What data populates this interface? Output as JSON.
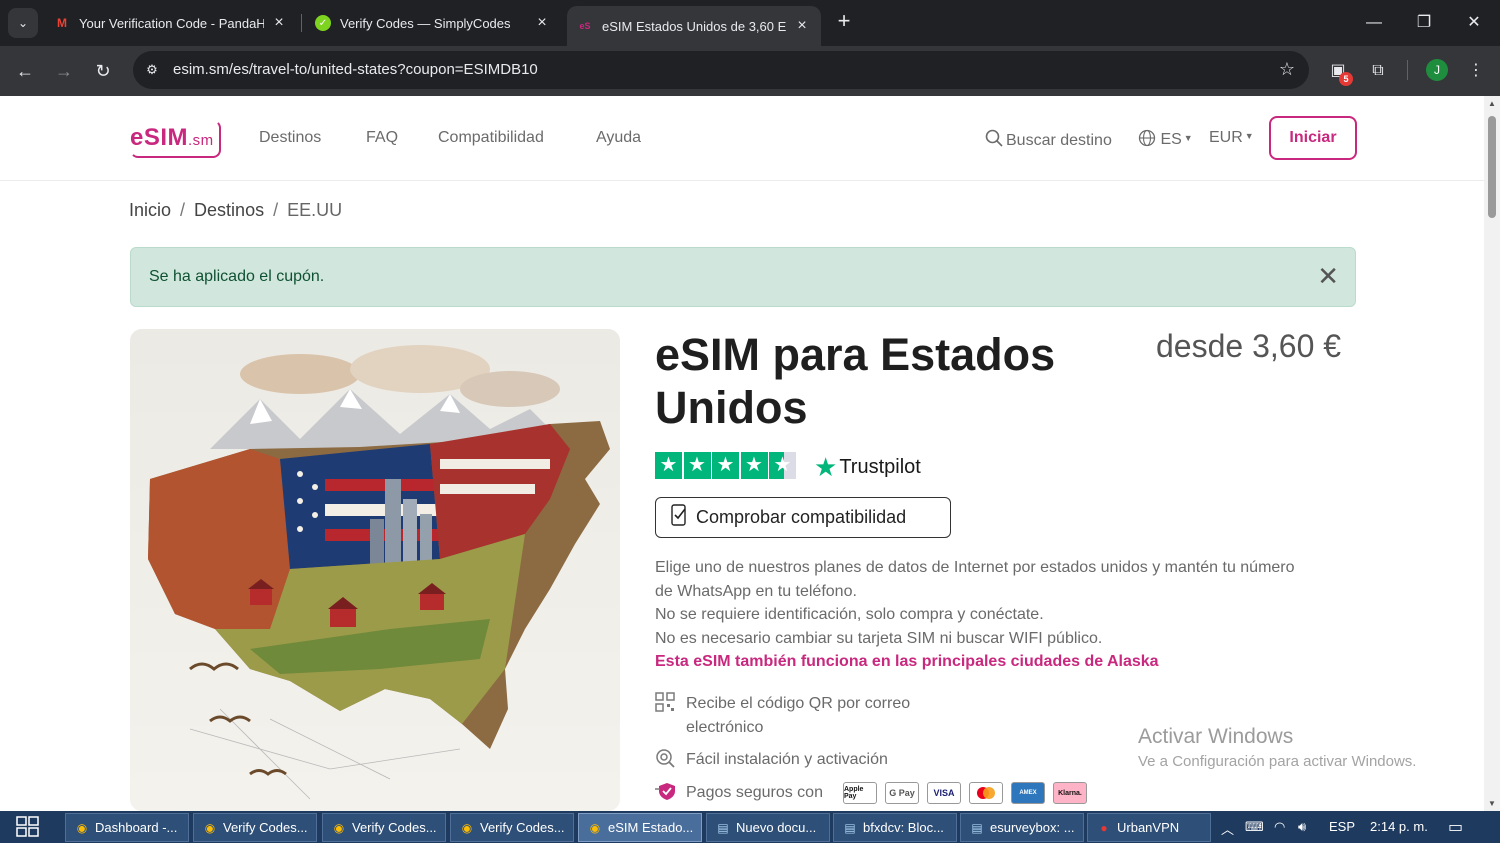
{
  "browser": {
    "tabs": [
      {
        "title": "Your Verification Code - PandaH",
        "favicon": "gmail-icon"
      },
      {
        "title": "Verify Codes — SimplyCodes",
        "favicon": "simplycodes-icon"
      },
      {
        "title": "eSIM Estados Unidos de 3,60 EU",
        "favicon": "esim-icon"
      }
    ],
    "url": "esim.sm/es/travel-to/united-states?coupon=ESIMDB10",
    "extensions_badge": "5",
    "profile_initial": "J"
  },
  "header": {
    "logo_main": "eSIM",
    "logo_sub": ".sm",
    "nav": [
      "Destinos",
      "FAQ",
      "Compatibilidad",
      "Ayuda"
    ],
    "search": "Buscar destino",
    "language": "ES",
    "currency": "EUR",
    "login": "Iniciar"
  },
  "breadcrumb": {
    "items": [
      "Inicio",
      "Destinos",
      "EE.UU"
    ],
    "separator": "/"
  },
  "alert": {
    "message": "Se ha aplicado el cupón."
  },
  "product": {
    "title": "eSIM para Estados Unidos",
    "price": "desde 3,60 €",
    "rating_stars": 4.5,
    "trustpilot": "Trustpilot",
    "compat_button": "Comprobar compatibilidad",
    "description": [
      "Elige uno de nuestros planes de datos de Internet por estados unidos y mantén tu número de WhatsApp en tu teléfono.",
      "No se requiere identificación, solo compra y conéctate.",
      "No es necesario cambiar su tarjeta SIM ni buscar WIFI público."
    ],
    "highlight": "Esta eSIM también funciona en las principales ciudades de Alaska",
    "features": [
      {
        "icon": "qr-code-icon",
        "text": "Recibe el código QR por correo",
        "text2": "electrónico"
      },
      {
        "icon": "install-icon",
        "text": "Fácil instalación y activación"
      },
      {
        "icon": "secure-payment-icon",
        "text": "Pagos seguros con"
      }
    ],
    "payment_methods": [
      "Apple Pay",
      "G Pay",
      "VISA",
      "Mastercard",
      "AMEX",
      "Klarna."
    ]
  },
  "watermark": {
    "line1": "Activar Windows",
    "line2": "Ve a Configuración para activar Windows."
  },
  "taskbar": {
    "items": [
      {
        "label": "Dashboard -...",
        "icon": "chrome-icon"
      },
      {
        "label": "Verify Codes...",
        "icon": "chrome-icon"
      },
      {
        "label": "Verify Codes...",
        "icon": "chrome-icon"
      },
      {
        "label": "Verify Codes...",
        "icon": "chrome-icon"
      },
      {
        "label": "eSIM Estado...",
        "icon": "chrome-icon"
      },
      {
        "label": "Nuevo docu...",
        "icon": "notepad-icon"
      },
      {
        "label": "bfxdcv: Bloc...",
        "icon": "notepad-icon"
      },
      {
        "label": "esurveybox: ...",
        "icon": "notepad-icon"
      },
      {
        "label": "UrbanVPN",
        "icon": "urbanvpn-icon"
      }
    ],
    "language": "ESP",
    "clock": "2:14 p. m."
  },
  "colors": {
    "brand": "#c8287e",
    "alert_bg": "#d1e7dd",
    "alert_text": "#0f5132",
    "trustpilot": "#00b67a",
    "taskbar": "#1f3a5f"
  }
}
